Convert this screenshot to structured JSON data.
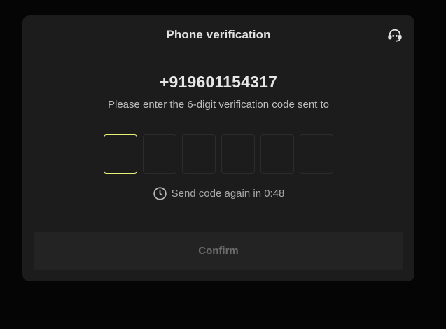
{
  "modal": {
    "title": "Phone verification",
    "support_icon": "headset-support-icon"
  },
  "verification": {
    "phone_number": "+919601154317",
    "instructions": "Please enter the 6-digit verification code sent to",
    "code_length": 6,
    "code_digits": [
      "",
      "",
      "",
      "",
      "",
      ""
    ],
    "active_index": 0
  },
  "resend": {
    "icon": "clock-icon",
    "text": "Send code again in 0:48"
  },
  "confirm": {
    "label": "Confirm",
    "disabled": true
  },
  "colors": {
    "background": "#050505",
    "modal": "#1c1c1c",
    "active_border": "#e8f07a",
    "button": "#232323",
    "button_text_disabled": "#6b6b6b"
  }
}
